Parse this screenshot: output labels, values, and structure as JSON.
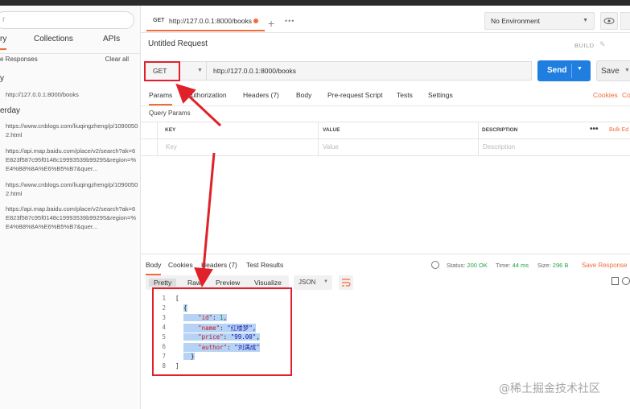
{
  "sidebar": {
    "filter_placeholder": "r",
    "tabs": [
      "ry",
      "Collections",
      "APIs"
    ],
    "save_responses": "e Responses",
    "clear_all": "Clear all",
    "groups": [
      {
        "label": "y",
        "items": [
          "http://127.0.0.1:8000/books"
        ]
      },
      {
        "label": "erday",
        "items": [
          "https://www.cnblogs.com/liuqingzheng/p/10900502.html",
          "https://api.map.baidu.com/place/v2/search?ak=6E823f587c95f0148c19993539b99295&region=%E4%B8%8A%E6%B5%B7&quer...",
          "https://www.cnblogs.com/liuqingzheng/p/10900502.html",
          "https://api.map.baidu.com/place/v2/search?ak=6E823f587c95f0148c19993539b99295&region=%E4%B8%8A%E6%B5%B7&quer..."
        ]
      }
    ]
  },
  "tabbar": {
    "tab_method": "GET",
    "tab_url": "http://127.0.0.1:8000/books",
    "environment": "No Environment"
  },
  "request": {
    "title": "Untitled Request",
    "build": "BUILD",
    "method": "GET",
    "url": "http://127.0.0.1:8000/books",
    "send": "Send",
    "save": "Save",
    "tabs": [
      "Params",
      "Authorization",
      "Headers (7)",
      "Body",
      "Pre-request Script",
      "Tests",
      "Settings"
    ],
    "cookies": "Cookies",
    "code": "Co",
    "query_params_title": "Query Params",
    "table_headers": [
      "KEY",
      "VALUE",
      "DESCRIPTION",
      "Bulk Ed"
    ],
    "table_placeholders": [
      "Key",
      "Value",
      "Description"
    ]
  },
  "response": {
    "tabs": [
      "Body",
      "Cookies",
      "Headers (7)",
      "Test Results"
    ],
    "status_label": "Status:",
    "status_value": "200 OK",
    "time_label": "Time:",
    "time_value": "44 ms",
    "size_label": "Size:",
    "size_value": "296 B",
    "save_response": "Save Response",
    "views": [
      "Pretty",
      "Raw",
      "Preview",
      "Visualize"
    ],
    "format": "JSON",
    "code_lines": [
      {
        "n": "1",
        "text": "["
      },
      {
        "n": "2",
        "text": "{"
      },
      {
        "n": "3",
        "key": "\"id\"",
        "val": "1",
        "type": "num"
      },
      {
        "n": "4",
        "key": "\"name\"",
        "val": "\"红楼梦\"",
        "type": "str"
      },
      {
        "n": "5",
        "key": "\"price\"",
        "val": "\"99.00\"",
        "type": "str"
      },
      {
        "n": "6",
        "key": "\"author\"",
        "val": "\"刘满成\"",
        "type": "str"
      },
      {
        "n": "7",
        "text": "}"
      },
      {
        "n": "8",
        "text": "]"
      }
    ]
  },
  "watermark": "@稀土掘金技术社区",
  "colors": {
    "accent": "#f26b3a",
    "send": "#1f7ee0",
    "annotation": "#e0212b"
  }
}
